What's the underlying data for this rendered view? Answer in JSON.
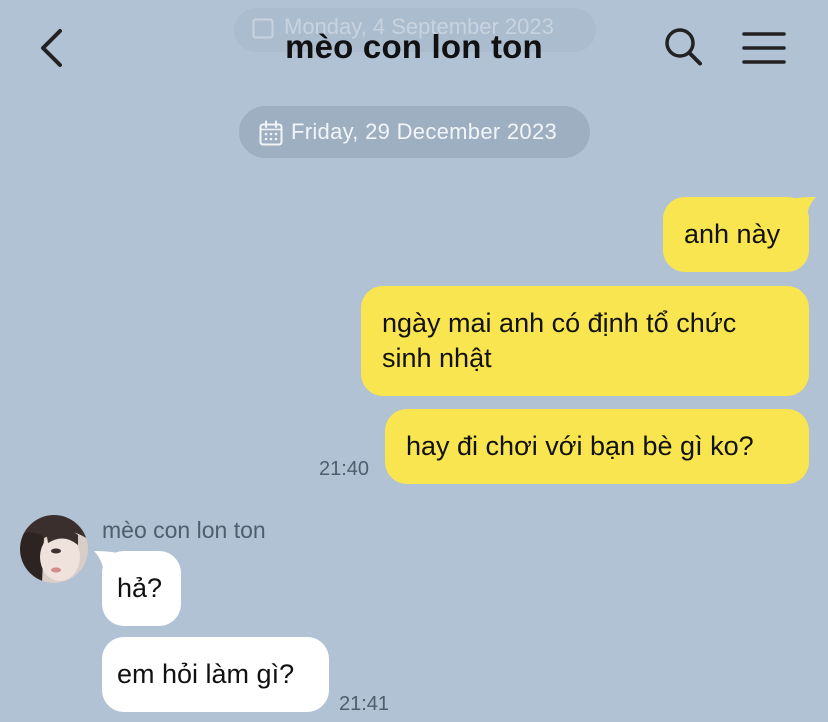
{
  "header": {
    "title": "mèo con lon ton",
    "faded_date": "Monday, 4 September 2023"
  },
  "date_divider": "Friday, 29 December 2023",
  "messages": [
    {
      "side": "out",
      "text": "anh này"
    },
    {
      "side": "out",
      "lines": [
        "ngày mai anh có định tổ chức",
        "sinh nhật"
      ]
    },
    {
      "side": "out",
      "text": "hay đi chơi với bạn bè gì ko?",
      "time": "21:40"
    },
    {
      "side": "in",
      "sender": "mèo con lon ton",
      "text": "hả?"
    },
    {
      "side": "in",
      "text": "em hỏi làm gì?",
      "time": "21:41"
    }
  ],
  "colors": {
    "background": "#b1c2d4",
    "outgoing_bubble": "#f9e54f",
    "incoming_bubble": "#ffffff"
  },
  "icons": {
    "back": "chevron-left-icon",
    "search": "search-icon",
    "menu": "hamburger-menu-icon",
    "date": "calendar-icon"
  }
}
